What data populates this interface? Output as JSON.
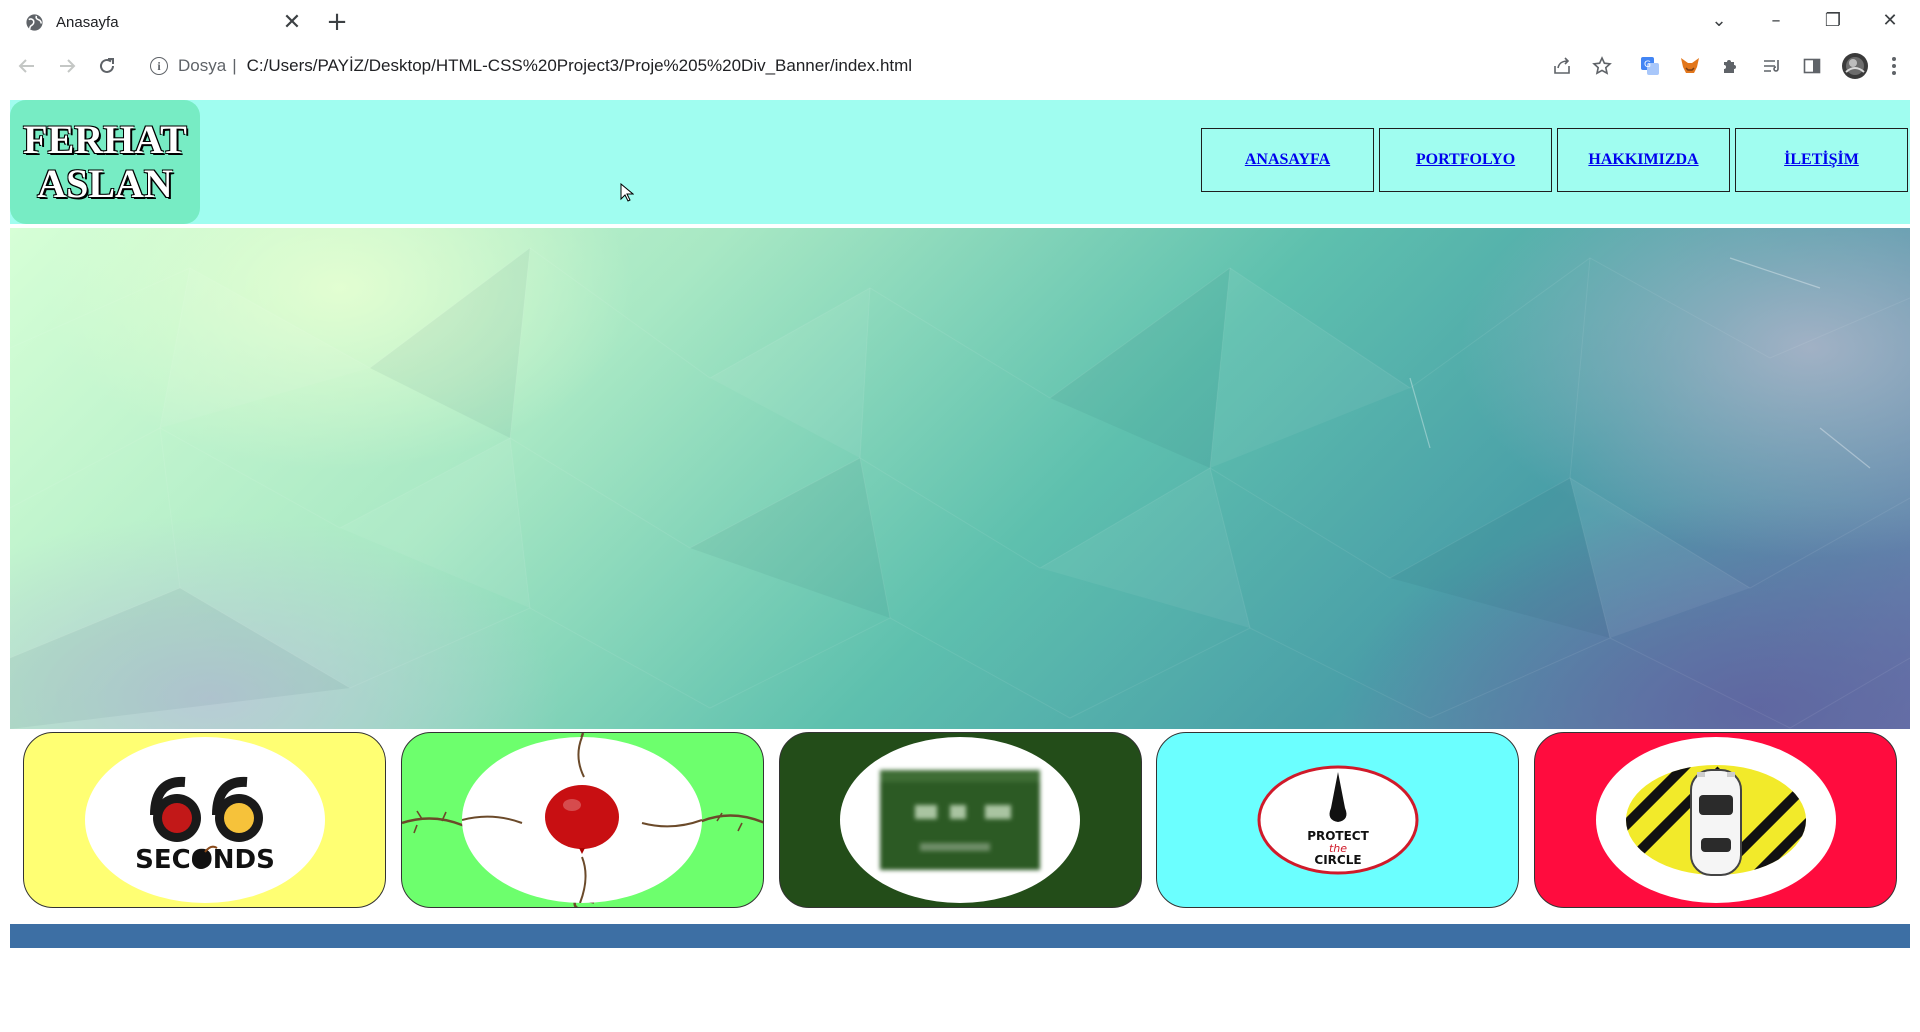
{
  "browser": {
    "tab_title": "Anasayfa",
    "close_glyph": "✕",
    "new_tab_glyph": "+",
    "window_controls": {
      "tab_search": "⌄",
      "minimize": "–",
      "restore": "❐",
      "close": "✕"
    },
    "omnibox": {
      "scheme_label": "Dosya",
      "separator": "|",
      "url": "C:/Users/PAYİZ/Desktop/HTML-CSS%20Project3/Proje%205%20Div_Banner/index.html"
    }
  },
  "header": {
    "logo_line1": "FERHAT",
    "logo_line2": "ASLAN",
    "nav": [
      {
        "label": "ANASAYFA"
      },
      {
        "label": "PORTFOLYO"
      },
      {
        "label": "HAKKIMIZDA"
      },
      {
        "label": "İLETİŞİM"
      }
    ]
  },
  "cards": [
    {
      "name": "66 Seconds",
      "background": "#ffff73",
      "logo_text_top": "66",
      "logo_text_bottom": "SECONDS"
    },
    {
      "name": "balloon",
      "background": "#6dff6d"
    },
    {
      "name": "math game",
      "background": "#234d19"
    },
    {
      "name": "Protect the Circle",
      "background": "#6bffff",
      "logo_line1": "PROTECT",
      "logo_line2": "the",
      "logo_line3": "CIRCLE"
    },
    {
      "name": "car game",
      "background": "#ff0c3e"
    }
  ],
  "colors": {
    "header_bg": "#a0fdf0",
    "logo_bg": "#77ecc4",
    "footer_bg": "#3d6fa4",
    "link": "#0000ee"
  },
  "icons": [
    "globe-icon",
    "back-icon",
    "forward-icon",
    "reload-icon",
    "info-icon",
    "share-icon",
    "star-icon",
    "translate-icon",
    "fox-extension-icon",
    "puzzle-extension-icon",
    "reading-list-icon",
    "side-panel-icon",
    "profile-avatar",
    "kebab-menu-icon"
  ]
}
